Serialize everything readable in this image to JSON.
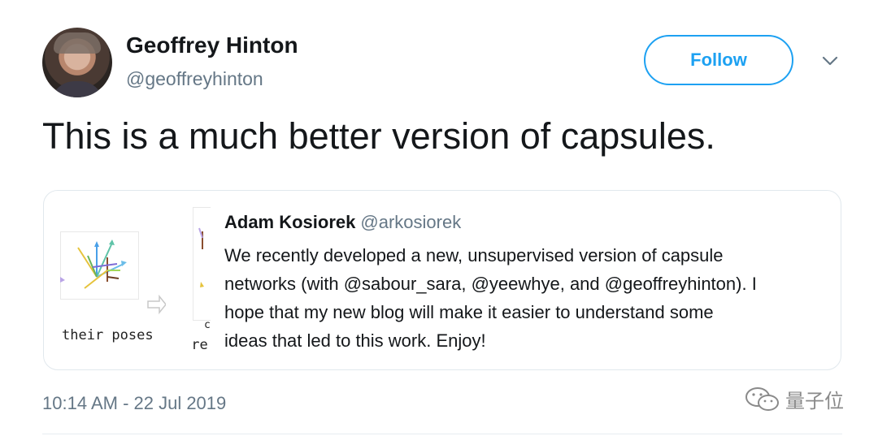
{
  "author": {
    "name": "Geoffrey Hinton",
    "handle": "@geoffreyhinton",
    "avatar_icon": "profile-photo"
  },
  "follow_button": {
    "label": "Follow",
    "color": "#1da1f2"
  },
  "menu_icon": "chevron-down-icon",
  "tweet": {
    "text": "This is a much better version of capsules.",
    "timestamp": "10:14 AM - 22 Jul 2019"
  },
  "quoted_tweet": {
    "author_name": "Adam Kosiorek",
    "author_handle": "@arkosiorek",
    "body_lines": [
      "We recently developed a new, unsupervised version of capsule",
      "networks (with @sabour_sara, @yeewhye,  and @geoffreyhinton). I",
      "hope that my new blog will make it easier to understand some",
      "ideas that led to this work. Enjoy!"
    ],
    "thumbnail": {
      "caption_left": "their poses",
      "caption_right": "pre",
      "caption_right_top": "c"
    }
  },
  "watermark": {
    "text": "量子位",
    "icon": "wechat-icon"
  },
  "colors": {
    "text": "#14171a",
    "secondary": "#657786",
    "border": "#e1e8ed"
  }
}
